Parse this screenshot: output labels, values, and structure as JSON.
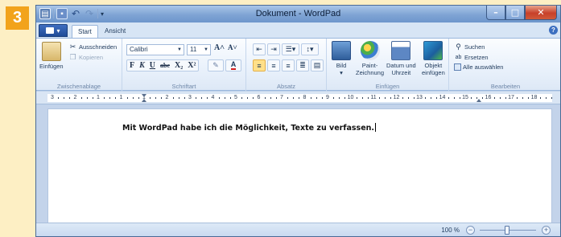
{
  "step": {
    "number": "3"
  },
  "window": {
    "title": "Dokument - WordPad",
    "controls": {
      "minimize": "–",
      "maximize": "□",
      "close": "✕"
    }
  },
  "quick_access": {
    "icons": [
      "app-icon",
      "save-icon",
      "undo-icon",
      "redo-icon",
      "customize-dropdown-icon"
    ]
  },
  "tabs": [
    {
      "label": "Start",
      "active": true
    },
    {
      "label": "Ansicht",
      "active": false
    }
  ],
  "help": {
    "label": "?"
  },
  "ribbon": {
    "clipboard": {
      "label": "Zwischenablage",
      "paste_label": "Einfügen",
      "cut_label": "Ausschneiden",
      "copy_label": "Kopieren"
    },
    "font": {
      "label": "Schriftart",
      "family": "Calibri",
      "size": "11",
      "grow": "A˄",
      "shrink": "A˅",
      "bold": "F",
      "italic": "K",
      "underline": "U",
      "strike": "abe",
      "subscript": "X₂",
      "superscript": "X²"
    },
    "paragraph": {
      "label": "Absatz"
    },
    "insert": {
      "label": "Einfügen",
      "picture_label": "Bild",
      "paint_label_1": "Paint-",
      "paint_label_2": "Zeichnung",
      "datetime_label_1": "Datum und",
      "datetime_label_2": "Uhrzeit",
      "object_label_1": "Objekt",
      "object_label_2": "einfügen"
    },
    "edit": {
      "label": "Bearbeiten",
      "find_label": "Suchen",
      "replace_label": "Ersetzen",
      "select_all_label": "Alle auswählen"
    }
  },
  "ruler": {
    "ticks": [
      "3",
      "2",
      "1",
      "1",
      "1",
      "2",
      "3",
      "4",
      "5",
      "6",
      "7",
      "8",
      "9",
      "10",
      "11",
      "12",
      "13",
      "14",
      "15",
      "16",
      "17",
      "18"
    ]
  },
  "document": {
    "text": "Mit WordPad habe ich die Möglichkeit, Texte zu verfassen."
  },
  "status": {
    "zoom": "100 %",
    "zoom_out": "−",
    "zoom_in": "+",
    "zoom_level": 0.5
  },
  "colors": {
    "badge": "#f2a31b",
    "background": "#fdefc4",
    "title_bar": "#7fa4d4",
    "close_button": "#c8402a",
    "ribbon": "#e9f1fb"
  }
}
